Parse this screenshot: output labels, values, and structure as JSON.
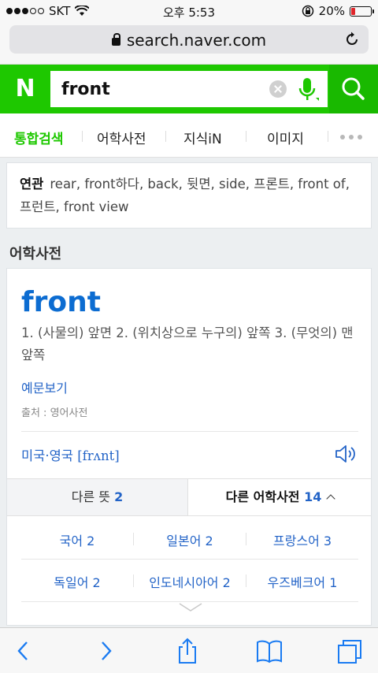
{
  "status_bar": {
    "carrier": "SKT",
    "time": "오후 5:53",
    "battery": "20%",
    "battery_level": 0.2,
    "battery_color": "#e0262b"
  },
  "url_bar": {
    "url": "search.naver.com",
    "lock_icon": "lock-icon",
    "reload_icon": "reload-icon"
  },
  "search": {
    "logo": "N",
    "query": "front",
    "brand_color": "#1ec800",
    "clear_icon": "close-icon",
    "mic_icon": "microphone-icon",
    "search_icon": "search-icon"
  },
  "tabs": [
    {
      "label": "통합검색",
      "active": true
    },
    {
      "label": "어학사전",
      "active": false
    },
    {
      "label": "지식iN",
      "active": false
    },
    {
      "label": "이미지",
      "active": false
    }
  ],
  "related": {
    "label": "연관",
    "text": "rear, front하다, back, 뒷면, side, 프론트, front of, 프런트, front view"
  },
  "dictionary": {
    "section_title": "어학사전",
    "word": "front",
    "meanings": "1. (사물의) 앞면   2. (위치상으로 누구의) 앞쪽   3. (무엇의) 맨 앞쪽",
    "examples_link": "예문보기",
    "source": "출처 : 영어사전",
    "pron_label": "미국·영국",
    "pron": "[frʌnt]",
    "other_meanings_label": "다른 뜻",
    "other_meanings_count": "2",
    "other_dicts_label": "다른 어학사전",
    "other_dicts_count": "14",
    "languages": [
      {
        "name": "국어",
        "count": "2"
      },
      {
        "name": "일본어",
        "count": "2"
      },
      {
        "name": "프랑스어",
        "count": "3"
      },
      {
        "name": "독일어",
        "count": "2"
      },
      {
        "name": "인도네시아어",
        "count": "2"
      },
      {
        "name": "우즈베크어",
        "count": "1"
      }
    ]
  },
  "toolbar": {
    "icons": [
      "back-icon",
      "forward-icon",
      "share-icon",
      "bookmarks-icon",
      "tabs-icon"
    ]
  }
}
